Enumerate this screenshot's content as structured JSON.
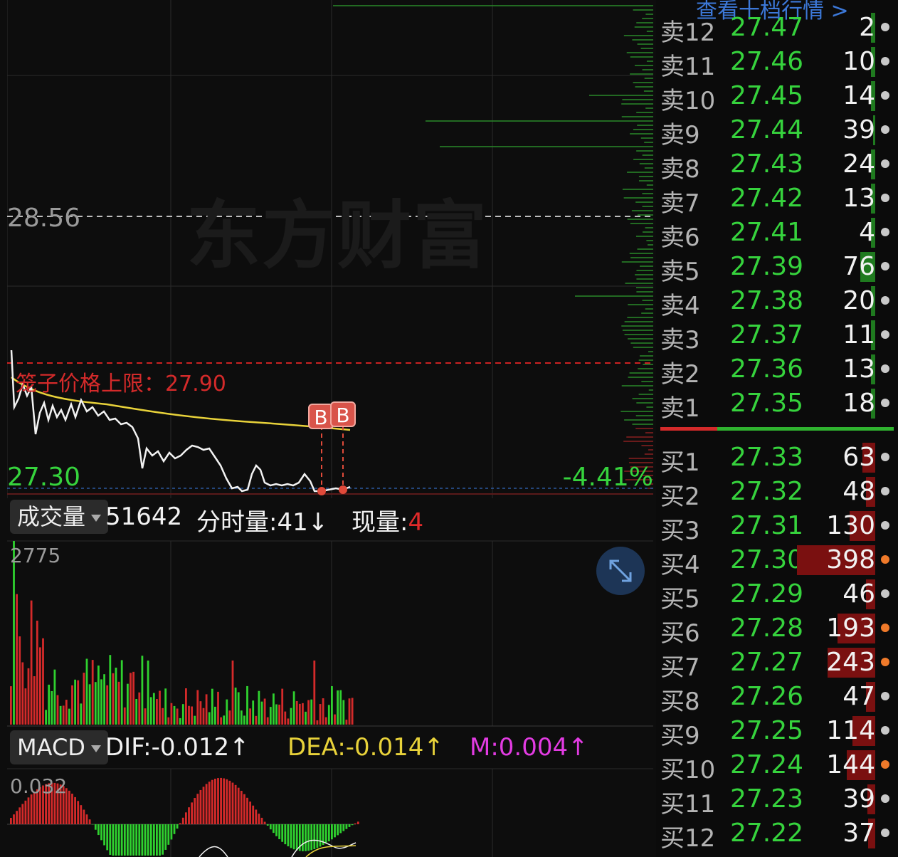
{
  "watermark": "东方财富",
  "price_chart": {
    "ref_price": "28.56",
    "low_label": "27.30",
    "pct_change": "-4.41%",
    "cage_label": "笼子价格上限：27.90",
    "markers": [
      "B",
      "B"
    ]
  },
  "volume_panel": {
    "selector": "成交量",
    "total": "51642",
    "minute_label": "分时量:41↓",
    "now_label": "现量:",
    "now_value": "4",
    "axis_max": "2775"
  },
  "macd_panel": {
    "selector": "MACD",
    "dif": "DIF:-0.012↑",
    "dea": "DEA:-0.014↑",
    "m": "M:0.004↑",
    "axis_max": "0.032"
  },
  "order_book": {
    "header_link": "查看十档行情 >",
    "sells": [
      {
        "name": "卖12",
        "price": "27.47",
        "vol": "2",
        "bar": 0
      },
      {
        "name": "卖11",
        "price": "27.46",
        "vol": "10",
        "bar": 0
      },
      {
        "name": "卖10",
        "price": "27.45",
        "vol": "14",
        "bar": 0
      },
      {
        "name": "卖9",
        "price": "27.44",
        "vol": "39",
        "bar": 0.03
      },
      {
        "name": "卖8",
        "price": "27.43",
        "vol": "24",
        "bar": 0
      },
      {
        "name": "卖7",
        "price": "27.42",
        "vol": "13",
        "bar": 0
      },
      {
        "name": "卖6",
        "price": "27.41",
        "vol": "4",
        "bar": 0
      },
      {
        "name": "卖5",
        "price": "27.39",
        "vol": "76",
        "bar": 0.19
      },
      {
        "name": "卖4",
        "price": "27.38",
        "vol": "20",
        "bar": 0
      },
      {
        "name": "卖3",
        "price": "27.37",
        "vol": "11",
        "bar": 0
      },
      {
        "name": "卖2",
        "price": "27.36",
        "vol": "13",
        "bar": 0
      },
      {
        "name": "卖1",
        "price": "27.35",
        "vol": "18",
        "bar": 0
      }
    ],
    "buys": [
      {
        "name": "买1",
        "price": "27.33",
        "vol": "63",
        "bar": 0.16,
        "dot": "#c9c9c9"
      },
      {
        "name": "买2",
        "price": "27.32",
        "vol": "48",
        "bar": 0.12,
        "dot": "#c9c9c9"
      },
      {
        "name": "买3",
        "price": "27.31",
        "vol": "130",
        "bar": 0.33,
        "dot": "#c9c9c9"
      },
      {
        "name": "买4",
        "price": "27.30",
        "vol": "398",
        "bar": 1.0,
        "dot": "#f07a2a"
      },
      {
        "name": "买5",
        "price": "27.29",
        "vol": "46",
        "bar": 0.12,
        "dot": "#c9c9c9"
      },
      {
        "name": "买6",
        "price": "27.28",
        "vol": "193",
        "bar": 0.48,
        "dot": "#f07a2a"
      },
      {
        "name": "买7",
        "price": "27.27",
        "vol": "243",
        "bar": 0.61,
        "dot": "#f07a2a"
      },
      {
        "name": "买8",
        "price": "27.26",
        "vol": "47",
        "bar": 0.12,
        "dot": "#c9c9c9"
      },
      {
        "name": "买9",
        "price": "27.25",
        "vol": "114",
        "bar": 0.29,
        "dot": "#c9c9c9"
      },
      {
        "name": "买10",
        "price": "27.24",
        "vol": "144",
        "bar": 0.36,
        "dot": "#f07a2a"
      },
      {
        "name": "买11",
        "price": "27.23",
        "vol": "39",
        "bar": 0.1,
        "dot": "#c9c9c9"
      },
      {
        "name": "买12",
        "price": "27.22",
        "vol": "37",
        "bar": 0.09,
        "dot": "#c9c9c9"
      }
    ]
  },
  "colors": {
    "up": "#e02a2a",
    "down": "#2fd12f",
    "avg_line": "#e8d23a",
    "price_line": "#f2f2f2",
    "accent_blue": "#3c78d8",
    "macd_m": "#e23be2"
  }
}
